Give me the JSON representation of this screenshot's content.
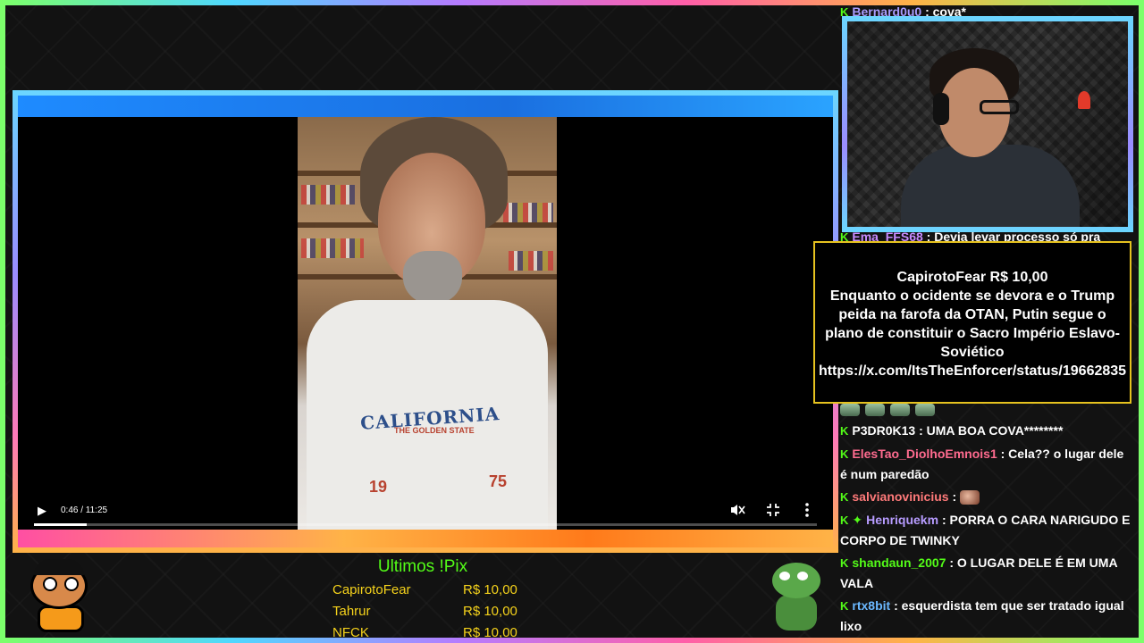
{
  "video": {
    "time": "0:46 / 11:25",
    "progress": 0.067,
    "shirt_text": "CALIFORNIA",
    "shirt_sub": "THE GOLDEN STATE",
    "shirt_year_left": "19",
    "shirt_year_right": "75"
  },
  "chat": {
    "messages": [
      {
        "user": "Bernard0u0",
        "user_color": "#a99cff",
        "text": ": cova*"
      },
      {
        "user": "Ema_FFS68",
        "user_color": "#c78bff",
        "text": ": Devia levar processo só pra"
      },
      {
        "user": "P3DR0K13",
        "user_color": "#ffffff",
        "text": ": UMA BOA COVA********"
      },
      {
        "user": "ElesTao_DiolhoEmnois1",
        "user_color": "#ff6b8f",
        "text": ": Cela?? o lugar dele é num paredão"
      },
      {
        "user": "salvianovinicius",
        "user_color": "#ff7a7a",
        "text": ":"
      },
      {
        "user": "Henriquekm",
        "user_color": "#b79cff",
        "text": ": PORRA O CARA NARIGUDO E CORPO DE TWINKY"
      },
      {
        "user": "shandaun_2007",
        "user_color": "#53fc18",
        "text": ": O LUGAR DELE É EM UMA VALA"
      },
      {
        "user": "rtx8bit",
        "user_color": "#6bb8ff",
        "text": ": esquerdista tem que ser tratado igual lixo"
      }
    ]
  },
  "alert": {
    "header": "CapirotoFear R$ 10,00",
    "message": "Enquanto o ocidente se devora e o Trump peida na farofa da OTAN, Putin segue o plano de constituir o Sacro Império Eslavo-Soviético",
    "link": "https://x.com/ItsTheEnforcer/status/19662835"
  },
  "pix": {
    "title": "Ultimos !Pix",
    "rows": [
      {
        "name": "CapirotoFear",
        "amount": "R$ 10,00"
      },
      {
        "name": "Tahrur",
        "amount": "R$ 10,00"
      },
      {
        "name": "NFCK",
        "amount": "R$ 10,00"
      }
    ]
  },
  "colors": {
    "kick_green": "#53fc18",
    "pix_yellow": "#f5d21b",
    "alert_border": "#e6c21f"
  },
  "icons": [
    "play-icon",
    "mute-icon",
    "exit-fullscreen-icon",
    "more-vertical-icon",
    "kick-badge-icon",
    "gem-badge-icon"
  ]
}
